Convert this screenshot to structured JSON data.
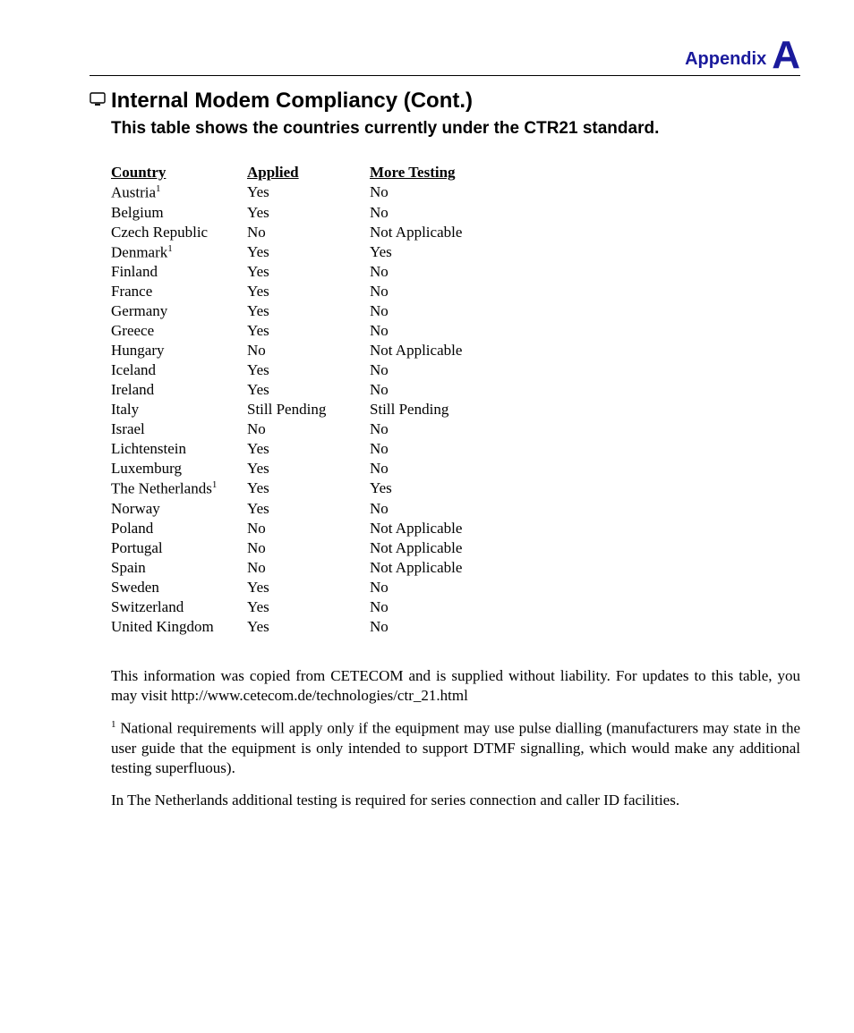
{
  "header": {
    "appendix_label": "Appendix",
    "appendix_letter": "A"
  },
  "title": "Internal Modem Compliancy (Cont.)",
  "subtitle": "This table shows the countries currently under the CTR21 standard.",
  "table": {
    "headers": [
      "Country",
      "Applied",
      "More Testing"
    ],
    "rows": [
      {
        "country": "Austria",
        "sup": "1",
        "applied": "Yes",
        "more": "No"
      },
      {
        "country": "Belgium",
        "sup": "",
        "applied": "Yes",
        "more": "No"
      },
      {
        "country": "Czech Republic",
        "sup": "",
        "applied": "No",
        "more": "Not Applicable"
      },
      {
        "country": "Denmark",
        "sup": "1",
        "applied": "Yes",
        "more": "Yes"
      },
      {
        "country": "Finland",
        "sup": "",
        "applied": "Yes",
        "more": "No"
      },
      {
        "country": "France",
        "sup": "",
        "applied": "Yes",
        "more": "No"
      },
      {
        "country": "Germany",
        "sup": "",
        "applied": "Yes",
        "more": "No"
      },
      {
        "country": "Greece",
        "sup": "",
        "applied": "Yes",
        "more": "No"
      },
      {
        "country": "Hungary",
        "sup": "",
        "applied": "No",
        "more": "Not Applicable"
      },
      {
        "country": "Iceland",
        "sup": "",
        "applied": "Yes",
        "more": "No"
      },
      {
        "country": "Ireland",
        "sup": "",
        "applied": "Yes",
        "more": "No"
      },
      {
        "country": "Italy",
        "sup": "",
        "applied": "Still Pending",
        "more": "Still Pending"
      },
      {
        "country": "Israel",
        "sup": "",
        "applied": "No",
        "more": "No"
      },
      {
        "country": "Lichtenstein",
        "sup": "",
        "applied": "Yes",
        "more": "No"
      },
      {
        "country": "Luxemburg",
        "sup": "",
        "applied": "Yes",
        "more": "No"
      },
      {
        "country": "The Netherlands",
        "sup": "1",
        "applied": "Yes",
        "more": "Yes"
      },
      {
        "country": "Norway",
        "sup": "",
        "applied": "Yes",
        "more": "No"
      },
      {
        "country": "Poland",
        "sup": "",
        "applied": "No",
        "more": "Not Applicable"
      },
      {
        "country": "Portugal",
        "sup": "",
        "applied": "No",
        "more": "Not Applicable"
      },
      {
        "country": "Spain",
        "sup": "",
        "applied": "No",
        "more": "Not Applicable"
      },
      {
        "country": "Sweden",
        "sup": "",
        "applied": "Yes",
        "more": "No"
      },
      {
        "country": "Switzerland",
        "sup": "",
        "applied": "Yes",
        "more": "No"
      },
      {
        "country": "United Kingdom",
        "sup": "",
        "applied": "Yes",
        "more": "No"
      }
    ]
  },
  "paragraphs": {
    "p1": "This information was copied from CETECOM and is supplied without liability. For updates to this table, you may visit http://www.cetecom.de/technologies/ctr_21.html",
    "p2_mark": "1",
    "p2": " National requirements will apply only if the equipment may use pulse dialling (manufacturers may state in the user guide that the equipment is only intended to support DTMF signalling, which would make any additional testing superfluous).",
    "p3": "In The Netherlands additional testing is required for series connection and caller ID facilities."
  }
}
